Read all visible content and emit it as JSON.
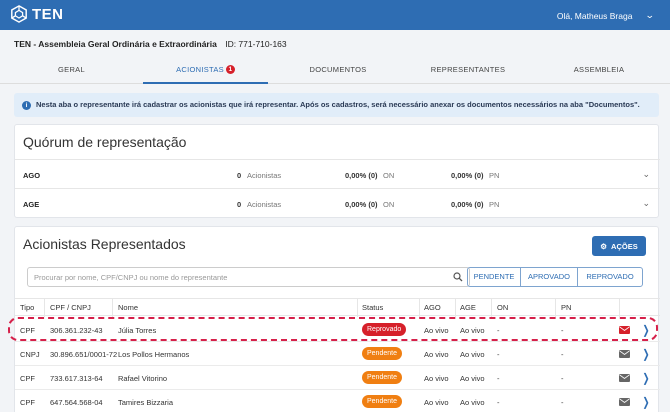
{
  "header": {
    "brand": "TEN",
    "greeting": "Olá, Matheus Braga",
    "accent": "#2e6db3"
  },
  "page": {
    "title": "TEN - Assembleia Geral Ordinária e Extraordinária",
    "id_text": "ID: 771-710-163"
  },
  "tabs": [
    {
      "label": "GERAL",
      "active": false
    },
    {
      "label": "ACIONISTAS",
      "active": true,
      "badge": "1"
    },
    {
      "label": "DOCUMENTOS",
      "active": false
    },
    {
      "label": "REPRESENTANTES",
      "active": false
    },
    {
      "label": "ASSEMBLEIA",
      "active": false
    }
  ],
  "info": {
    "text_bold": "Nesta aba o representante irá cadastrar os acionistas que irá representar. Após os cadastros, será necessário anexar os documentos necessários na aba \"Documentos\"."
  },
  "quorum": {
    "title": "Quórum de representação",
    "rows": [
      {
        "label": "AGO",
        "count": "0",
        "count_label": "Acionistas",
        "on_pct": "0,00% (0)",
        "on_label": "ON",
        "pn_pct": "0,00% (0)",
        "pn_label": "PN"
      },
      {
        "label": "AGE",
        "count": "0",
        "count_label": "Acionistas",
        "on_pct": "0,00% (0)",
        "on_label": "ON",
        "pn_pct": "0,00% (0)",
        "pn_label": "PN"
      }
    ]
  },
  "represented": {
    "title": "Acionistas Representados",
    "actions_label": "AÇÕES",
    "search_placeholder": "Procurar por nome, CPF/CNPJ ou nome do representante",
    "search_value": "",
    "filters": [
      "PENDENTE",
      "APROVADO",
      "REPROVADO"
    ],
    "columns": [
      "Tipo",
      "CPF / CNPJ",
      "Nome",
      "Status",
      "AGO",
      "AGE",
      "ON",
      "PN"
    ],
    "rows": [
      {
        "tipo": "CPF",
        "doc": "306.361.232-43",
        "nome": "Júlia Torres",
        "status": "Reprovado",
        "status_kind": "rep",
        "ago": "Ao vivo",
        "age": "Ao vivo",
        "on": "-",
        "pn": "-",
        "mail_color": "#d6202a"
      },
      {
        "tipo": "CNPJ",
        "doc": "30.896.651/0001-72",
        "nome": "Los Pollos Hermanos",
        "status": "Pendente",
        "status_kind": "pen",
        "ago": "Ao vivo",
        "age": "Ao vivo",
        "on": "-",
        "pn": "-",
        "mail_color": "#666666"
      },
      {
        "tipo": "CPF",
        "doc": "733.617.313-64",
        "nome": "Rafael Vitorino",
        "status": "Pendente",
        "status_kind": "pen",
        "ago": "Ao vivo",
        "age": "Ao vivo",
        "on": "-",
        "pn": "-",
        "mail_color": "#666666"
      },
      {
        "tipo": "CPF",
        "doc": "647.564.568-04",
        "nome": "Tamires Bizzaria",
        "status": "Pendente",
        "status_kind": "pen",
        "ago": "Ao vivo",
        "age": "Ao vivo",
        "on": "-",
        "pn": "-",
        "mail_color": "#666666"
      }
    ]
  }
}
